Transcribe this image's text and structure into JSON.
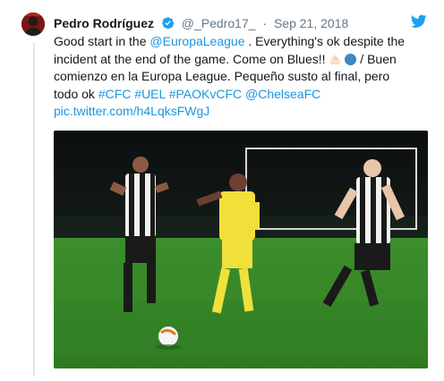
{
  "author": {
    "name": "Pedro Rodríguez",
    "handle": "@_Pedro17_",
    "separator": "·",
    "date": "Sep 21, 2018"
  },
  "tweet": {
    "seg1": "Good start in the ",
    "mention1": "@EuropaLeague",
    "seg2": " . Everything's ok despite the incident at the end of the game. Come on Blues!! ",
    "seg3": " / Buen comienzo en la Europa League. Pequeño susto al final, pero todo ok ",
    "tag1": "#CFC",
    "tag2": "#UEL",
    "tag3": "#PAOKvCFC",
    "mention2": "@ChelseaFC",
    "pic_link": "pic.twitter.com/h4LqksFWgJ"
  },
  "colors": {
    "link": "#1b95e0",
    "twitter_blue": "#1da1f2",
    "chelsea_kit": "#f2e03a",
    "paok_black": "#1a1a1a",
    "pitch": "#3a8a2a"
  },
  "icons": [
    "verified-badge-icon",
    "twitter-bird-icon",
    "flexed-biceps-emoji",
    "blue-circle-emoji"
  ]
}
